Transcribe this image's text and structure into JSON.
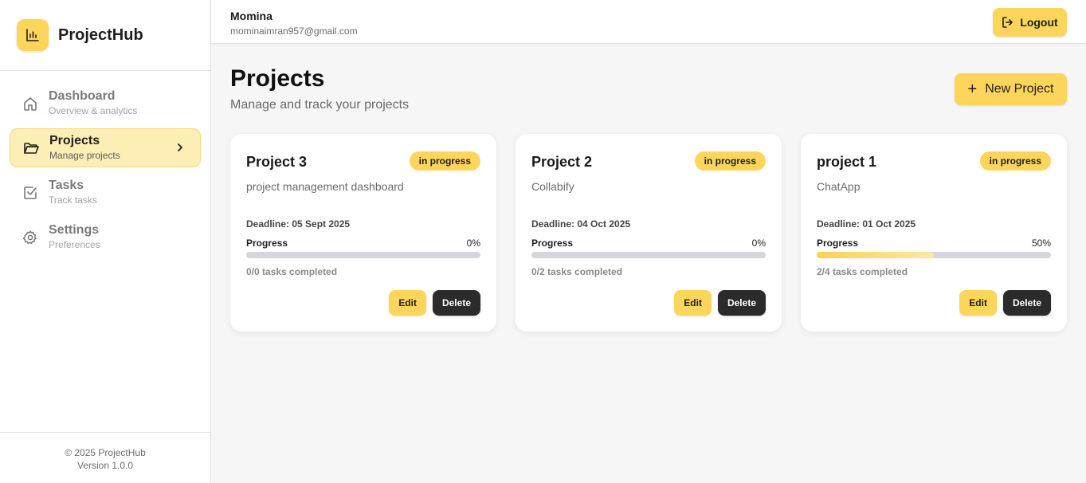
{
  "brand": {
    "name": "ProjectHub",
    "icon": "bar-chart-icon"
  },
  "sidebar": {
    "items": [
      {
        "label": "Dashboard",
        "sub": "Overview & analytics",
        "icon": "home-icon",
        "active": false
      },
      {
        "label": "Projects",
        "sub": "Manage projects",
        "icon": "folder-icon",
        "active": true
      },
      {
        "label": "Tasks",
        "sub": "Track tasks",
        "icon": "checkbox-icon",
        "active": false
      },
      {
        "label": "Settings",
        "sub": "Preferences",
        "icon": "gear-icon",
        "active": false
      }
    ],
    "footer": {
      "copyright": "© 2025 ProjectHub",
      "version": "Version 1.0.0"
    }
  },
  "header": {
    "user_name": "Momina",
    "user_email": "mominaimran957@gmail.com",
    "logout_label": "Logout"
  },
  "main": {
    "title": "Projects",
    "subtitle": "Manage and track your projects",
    "new_project_label": "New Project",
    "progress_label": "Progress",
    "edit_label": "Edit",
    "delete_label": "Delete",
    "projects": [
      {
        "name": "Project 3",
        "status": "in progress",
        "description": "project management dashboard",
        "deadline": "Deadline: 05 Sept 2025",
        "progress_text": "0%",
        "progress": 0,
        "tasks": "0/0 tasks completed"
      },
      {
        "name": "Project 2",
        "status": "in progress",
        "description": "Collabify",
        "deadline": "Deadline: 04 Oct 2025",
        "progress_text": "0%",
        "progress": 0,
        "tasks": "0/2 tasks completed"
      },
      {
        "name": "project 1",
        "status": "in progress",
        "description": "ChatApp",
        "deadline": "Deadline: 01 Oct 2025",
        "progress_text": "50%",
        "progress": 50,
        "tasks": "2/4 tasks completed"
      }
    ]
  },
  "colors": {
    "accent": "#fcd55a",
    "dark": "#2b2b2b",
    "active_bg": "#fdeeb5"
  }
}
